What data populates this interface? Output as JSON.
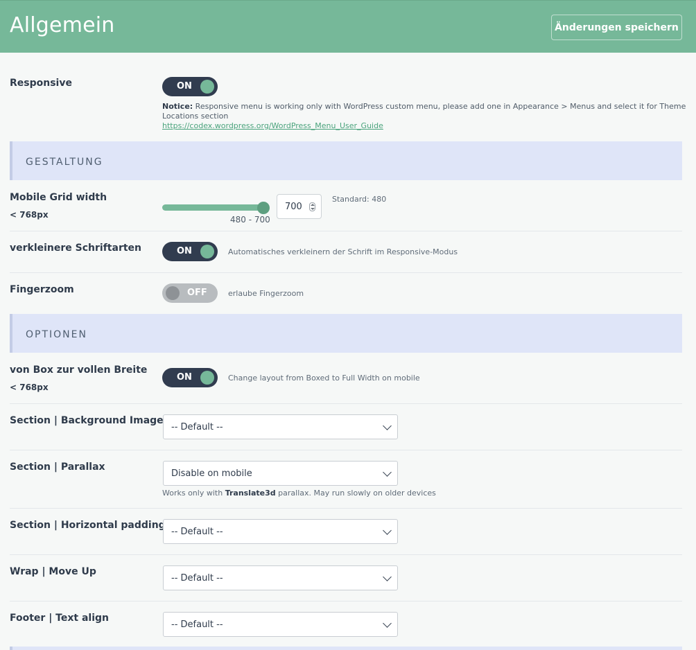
{
  "header": {
    "title": "Allgemein",
    "save_label": "Änderungen speichern"
  },
  "responsive": {
    "label": "Responsive",
    "toggle": "ON",
    "notice_bold": "Notice:",
    "notice_text": " Responsive menu is working only with WordPress custom menu, please add one in Appearance > Menus and select it for Theme Locations section",
    "link": "https://codex.wordpress.org/WordPress_Menu_User_Guide"
  },
  "sections": {
    "gestaltung": "GESTALTUNG",
    "optionen": "OPTIONEN"
  },
  "mobile_grid": {
    "label": "Mobile Grid width",
    "sublabel": "< 768px",
    "range": "480 - 700",
    "value": "700",
    "standard": "Standard: 480",
    "slider_min": 480,
    "slider_max": 700,
    "slider_value": 700
  },
  "font_shrink": {
    "label": "verkleinere Schriftarten",
    "toggle": "ON",
    "desc": "Automatisches verkleinern der Schrift im Responsive-Modus"
  },
  "fingerzoom": {
    "label": "Fingerzoom",
    "toggle": "OFF",
    "desc": "erlaube Fingerzoom"
  },
  "box_full": {
    "label": "von Box zur vollen Breite",
    "sublabel": "< 768px",
    "toggle": "ON",
    "desc": "Change layout from Boxed to Full Width on mobile"
  },
  "bg_image": {
    "label": "Section | Background Image",
    "value": "-- Default --"
  },
  "parallax": {
    "label": "Section | Parallax",
    "value": "Disable on mobile",
    "hint_pre": "Works only with ",
    "hint_bold": "Translate3d",
    "hint_post": " parallax. May run slowly on older devices"
  },
  "h_padding": {
    "label": "Section | Horizontal padding",
    "value": "-- Default --"
  },
  "wrap_move": {
    "label": "Wrap | Move Up",
    "value": "-- Default --"
  },
  "footer_align": {
    "label": "Footer | Text align",
    "value": "-- Default --"
  },
  "colors": {
    "accent": "#76b899",
    "toggle_on": "#313c4f",
    "section_bg": "#dfe5f8"
  }
}
